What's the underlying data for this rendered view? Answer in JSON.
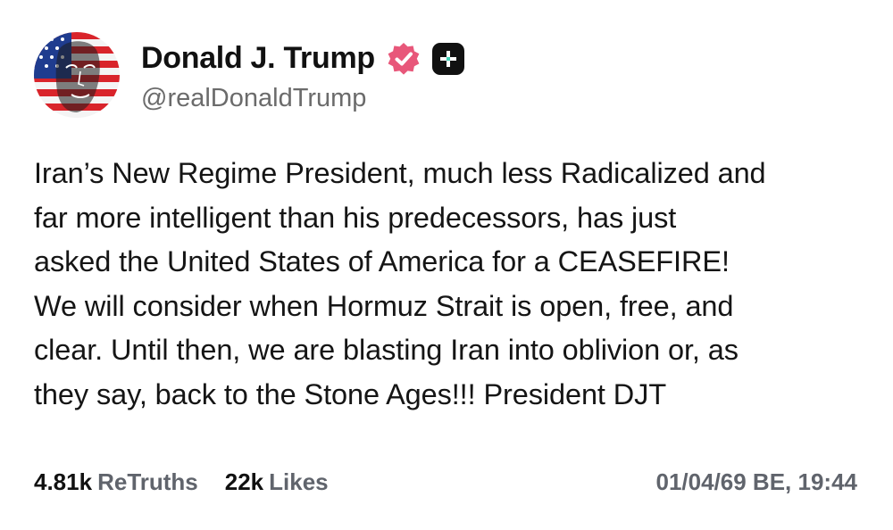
{
  "author": {
    "display_name": "Donald J. Trump",
    "handle": "@realDonaldTrump",
    "avatar_icon": "flag-portrait-avatar",
    "verified_icon": "verified-badge-icon",
    "verified_color": "#e8577a",
    "plus_icon": "plus-badge-icon",
    "plus_accent_color": "#3fd3b8"
  },
  "post": {
    "lines": [
      "Iran’s New Regime President, much less Radicalized and",
      "far more intelligent than his predecessors, has just",
      "asked the United States of America for a CEASEFIRE!",
      "We will consider when Hormuz Strait is open, free, and",
      "clear. Until then, we are blasting Iran into oblivion or, as",
      "they say, back to the Stone Ages!!! President DJT"
    ]
  },
  "stats": {
    "retruths_count": "4.81k",
    "retruths_label": "ReTruths",
    "likes_count": "22k",
    "likes_label": "Likes"
  },
  "timestamp": "01/04/69 BE, 19:44"
}
